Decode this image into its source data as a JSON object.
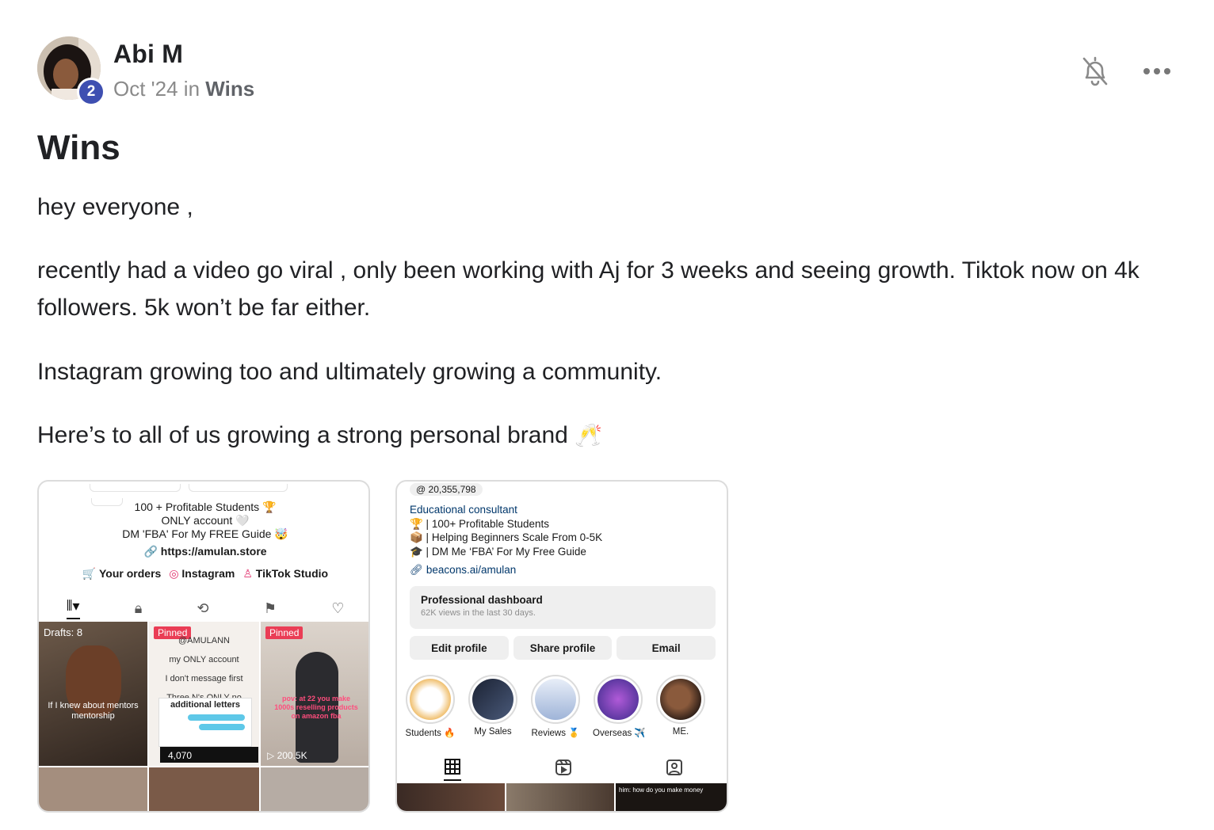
{
  "post": {
    "author": "Abi M",
    "level": "2",
    "date": "Oct '24",
    "in_word": "in",
    "category": "Wins",
    "title": "Wins",
    "paragraphs": [
      "hey everyone ,",
      "recently had a video go viral , only been working with Aj for 3 weeks and seeing growth. Tiktok now on 4k followers. 5k won’t be far either.",
      "Instagram growing too and ultimately growing a community.",
      "Here’s to all of us growing a strong personal brand"
    ],
    "closing_emoji": "🥂"
  },
  "icons": {
    "notifications": "bell-off-icon",
    "more": "more-horizontal-icon"
  },
  "tiktok_shot": {
    "bio_lines": [
      "100 + Profitable Students 🏆",
      "ONLY account 🤍",
      "DM 'FBA' For My FREE Guide 🤯"
    ],
    "link": "https://amulan.store",
    "links": [
      "Your orders",
      "Instagram",
      "TikTok Studio"
    ],
    "tiles": {
      "drafts": "Drafts: 8",
      "drafts_caption": "If I knew about mentors mentorship",
      "pinned1": "Pinned",
      "pinned1_lines": [
        "@AMULANN",
        "my ONLY account",
        "I don't message first",
        "Three N's ONLY no",
        "additional letters"
      ],
      "pinned1_views": "4,070",
      "pinned2": "Pinned",
      "pinned2_caption": "pov: at 22 you make 1000s reselling products on amazon fba",
      "pinned2_views": "200.5K"
    }
  },
  "instagram_shot": {
    "threads_count": "20,355,798",
    "category": "Educational consultant",
    "bio_lines": [
      "🏆 | 100+ Profitable Students",
      "📦 | Helping Beginners Scale From 0-5K",
      "🎓 | DM Me ‘FBA’ For My Free Guide"
    ],
    "link": "beacons.ai/amulan",
    "dashboard_title": "Professional dashboard",
    "dashboard_sub": "62K views in the last 30 days.",
    "buttons": [
      "Edit profile",
      "Share profile",
      "Email"
    ],
    "highlights": [
      "Students 🔥",
      "My Sales",
      "Reviews 🥇",
      "Overseas ✈️",
      "ME."
    ],
    "grid_caption": "him: how do you make money"
  }
}
